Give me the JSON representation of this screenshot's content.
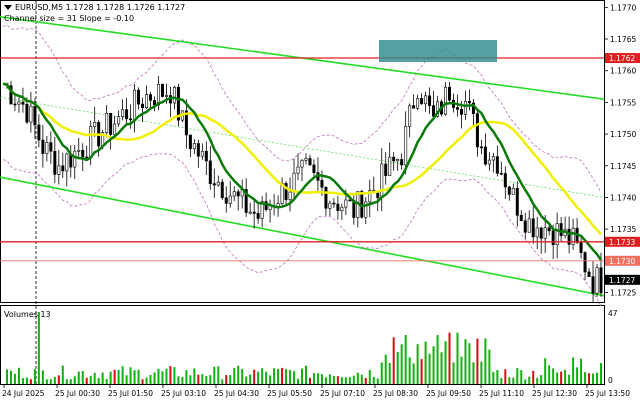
{
  "header": {
    "symbol_line": "EURUSD,M5  1.1728 1.1728 1.1726 1.1727",
    "indicator_line": "Channel size = 31 Slope = -0.10"
  },
  "volume_panel": {
    "label": "Volumes 13",
    "scale_max": "47",
    "scale_zero": "0"
  },
  "price_axis": {
    "ticks": [
      "1.1770",
      "1.1765",
      "1.1760",
      "1.1755",
      "1.1750",
      "1.1745",
      "1.1740",
      "1.1735",
      "1.1725"
    ]
  },
  "time_axis": {
    "labels": [
      "24 Jul 2025",
      "25 Jul 00:30",
      "25 Jul 01:50",
      "25 Jul 03:10",
      "25 Jul 04:30",
      "25 Jul 05:50",
      "25 Jul 07:10",
      "25 Jul 08:30",
      "25 Jul 09:50",
      "25 Jul 11:10",
      "25 Jul 12:30",
      "25 Jul 13:50"
    ]
  },
  "levels": [
    {
      "value": 1.1762,
      "label": "1.1762",
      "color": "#e02020",
      "style": "solid"
    },
    {
      "value": 1.1733,
      "label": "1.1733",
      "color": "#e02020",
      "style": "solid"
    },
    {
      "value": 1.173,
      "label": "1.1730",
      "color": "#f07060",
      "style": "thin"
    }
  ],
  "current_price": {
    "value": 1.1727,
    "label": "1.1727"
  },
  "colors": {
    "channel": "#22dd22",
    "ma_fast": "#0a7a0a",
    "ma_slow": "#f0f000",
    "bollinger": "#c070c0",
    "volume": "#10b010",
    "volume_down": "#d01010",
    "candles": "#000000",
    "highlight_box": "#2a8a8a"
  },
  "chart_data": {
    "type": "candlestick",
    "symbol": "EURUSD",
    "timeframe": "M5",
    "ylim": [
      1.17235,
      1.1771
    ],
    "yticks": [
      1.1725,
      1.1735,
      1.174,
      1.1745,
      1.175,
      1.1755,
      1.176,
      1.1765,
      1.177
    ],
    "close_path": [
      {
        "t": 0,
        "p": 1.1758
      },
      {
        "t": 6,
        "p": 1.1754
      },
      {
        "t": 10,
        "p": 1.1748
      },
      {
        "t": 14,
        "p": 1.1745
      },
      {
        "t": 20,
        "p": 1.1748
      },
      {
        "t": 28,
        "p": 1.1752
      },
      {
        "t": 36,
        "p": 1.1756
      },
      {
        "t": 42,
        "p": 1.1757
      },
      {
        "t": 46,
        "p": 1.175
      },
      {
        "t": 52,
        "p": 1.1744
      },
      {
        "t": 58,
        "p": 1.174
      },
      {
        "t": 64,
        "p": 1.1737
      },
      {
        "t": 70,
        "p": 1.1741
      },
      {
        "t": 76,
        "p": 1.1744
      },
      {
        "t": 82,
        "p": 1.174
      },
      {
        "t": 88,
        "p": 1.1738
      },
      {
        "t": 94,
        "p": 1.1742
      },
      {
        "t": 100,
        "p": 1.1747
      },
      {
        "t": 104,
        "p": 1.1758
      },
      {
        "t": 108,
        "p": 1.1752
      },
      {
        "t": 112,
        "p": 1.1757
      },
      {
        "t": 116,
        "p": 1.1755
      },
      {
        "t": 120,
        "p": 1.1748
      },
      {
        "t": 124,
        "p": 1.1746
      },
      {
        "t": 128,
        "p": 1.174
      },
      {
        "t": 132,
        "p": 1.1736
      },
      {
        "t": 138,
        "p": 1.1735
      },
      {
        "t": 143,
        "p": 1.1733
      },
      {
        "t": 148,
        "p": 1.1727
      }
    ],
    "volume_max": 47,
    "annotations": [
      "Channel size = 31 Slope = -0.10"
    ]
  }
}
